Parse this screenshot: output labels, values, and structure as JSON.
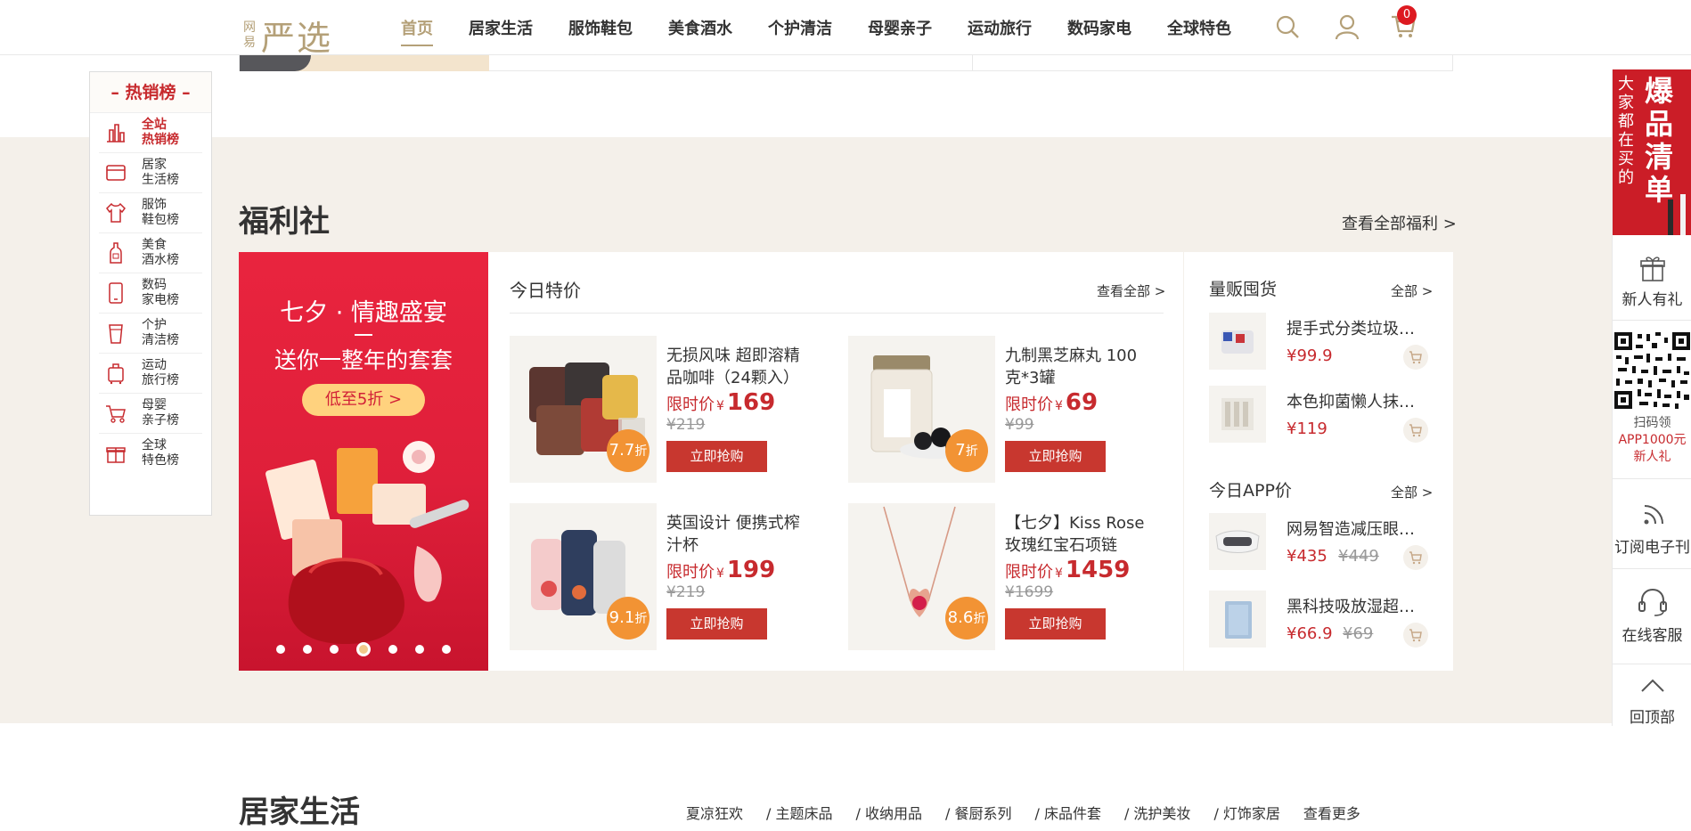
{
  "header": {
    "logo_small": [
      "网",
      "易"
    ],
    "logo_big": "严选",
    "nav": [
      "首页",
      "居家生活",
      "服饰鞋包",
      "美食酒水",
      "个护清洁",
      "母婴亲子",
      "运动旅行",
      "数码家电",
      "全球特色"
    ],
    "cart_count": "0"
  },
  "rank_nav": {
    "title": "热销榜",
    "items": [
      {
        "label1": "全站",
        "label2": "热销榜",
        "icon": "bar-chart-icon"
      },
      {
        "label1": "居家",
        "label2": "生活榜",
        "icon": "home-icon"
      },
      {
        "label1": "服饰",
        "label2": "鞋包榜",
        "icon": "shirt-icon"
      },
      {
        "label1": "美食",
        "label2": "酒水榜",
        "icon": "bottle-icon"
      },
      {
        "label1": "数码",
        "label2": "家电榜",
        "icon": "phone-icon"
      },
      {
        "label1": "个护",
        "label2": "清洁榜",
        "icon": "cup-icon"
      },
      {
        "label1": "运动",
        "label2": "旅行榜",
        "icon": "suitcase-icon"
      },
      {
        "label1": "母婴",
        "label2": "亲子榜",
        "icon": "stroller-icon"
      },
      {
        "label1": "全球",
        "label2": "特色榜",
        "icon": "gift-icon"
      }
    ]
  },
  "welfare": {
    "title": "福利社",
    "view_all": "查看全部福利 >",
    "banner": {
      "line1": "七夕 · 情趣盛宴",
      "line2": "送你一整年的套套",
      "button": "低至5折 >"
    },
    "deals": {
      "title": "今日特价",
      "view_all": "查看全部 >",
      "price_label": "限时价",
      "currency": "¥",
      "buy_label": "立即抢购",
      "items": [
        {
          "name": "无损风味 超即溶精品咖啡（24颗入）",
          "price": "169",
          "original": "¥219",
          "discount": "7.7",
          "disc_unit": "折"
        },
        {
          "name": "九制黑芝麻丸 100克*3罐",
          "price": "69",
          "original": "¥99",
          "discount": "7",
          "disc_unit": "折"
        },
        {
          "name": "英国设计 便携式榨汁杯",
          "price": "199",
          "original": "¥219",
          "discount": "9.1",
          "disc_unit": "折"
        },
        {
          "name": "【七夕】Kiss Rose 玫瑰红宝石项链",
          "price": "1459",
          "original": "¥1699",
          "discount": "8.6",
          "disc_unit": "折"
        }
      ]
    },
    "bulk": {
      "title": "量贩囤货",
      "view_all": "全部 >",
      "items": [
        {
          "name": "提手式分类垃圾袋...",
          "price": "¥99.9",
          "old": ""
        },
        {
          "name": "本色抑菌懒人抹布...",
          "price": "¥119",
          "old": ""
        }
      ]
    },
    "app": {
      "title": "今日APP价",
      "view_all": "全部 >",
      "items": [
        {
          "name": "网易智造减压眼部...",
          "price": "¥435",
          "old": "¥449"
        },
        {
          "name": "黑科技吸放湿超冷...",
          "price": "¥66.9",
          "old": "¥69"
        }
      ]
    }
  },
  "right_bar": {
    "hot_small": "大家都在买的",
    "hot_big": "爆品清单",
    "new_user": "新人有礼",
    "scan1": "扫码领",
    "scan2": "APP1000元",
    "scan3": "新人礼",
    "subscribe": "订阅电子刊",
    "service": "在线客服",
    "top": "回顶部"
  },
  "home_section": {
    "title": "居家生活",
    "tags": [
      "夏凉狂欢",
      "/ 主题床品",
      "/ 收纳用品",
      "/ 餐厨系列",
      "/ 床品件套",
      "/ 洗护美妆",
      "/ 灯饰家居",
      "查看更多"
    ]
  },
  "colors": {
    "accent": "#b4a078",
    "price_red": "#c72a2e",
    "section_bg": "#f4f0ea",
    "discount": "#f29334"
  }
}
